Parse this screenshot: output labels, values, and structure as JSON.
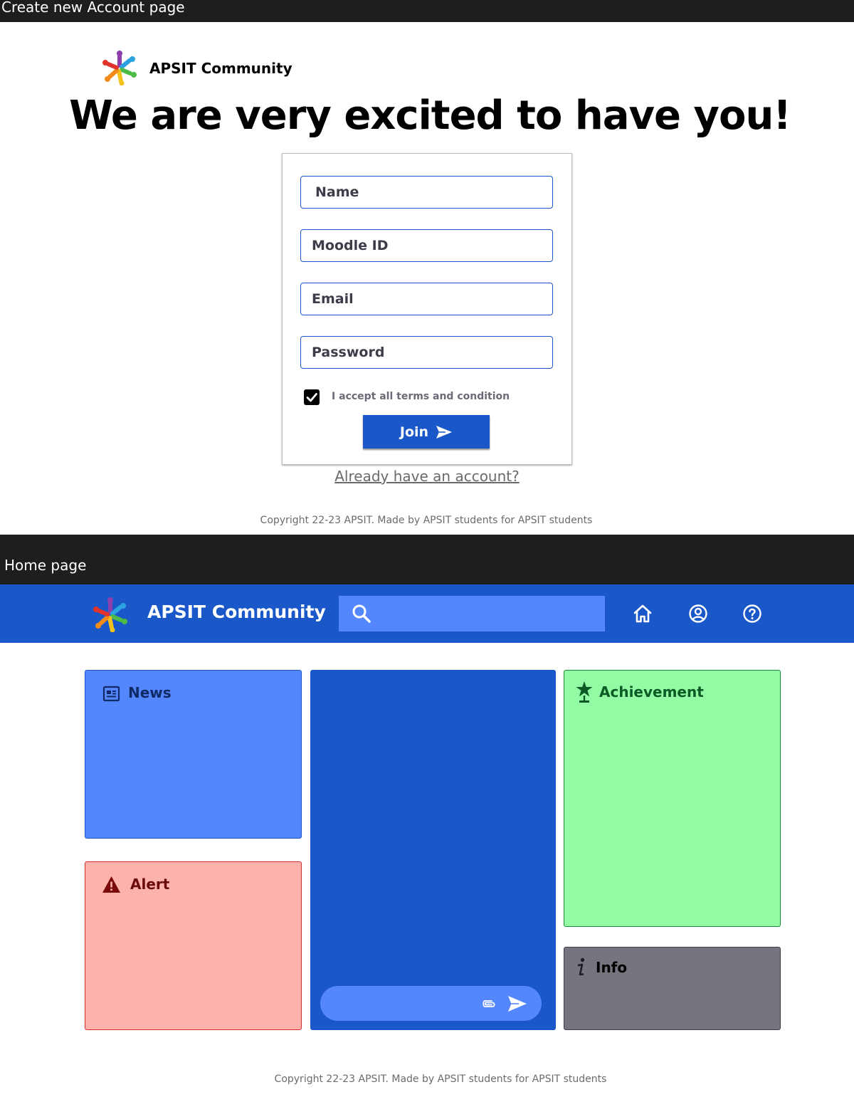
{
  "signup_section": {
    "header_label": "Create new Account page",
    "brand_name": "APSIT Community",
    "headline": "We are very excited to have you!",
    "form": {
      "name_placeholder": "Name",
      "moodle_placeholder": "Moodle ID",
      "email_placeholder": "Email",
      "password_placeholder": "Password",
      "terms_label": "I accept all terms and condition",
      "terms_checked": true,
      "join_label": "Join"
    },
    "login_link": "Already have an account?",
    "copyright": "Copyright 22-23 APSIT. Made by APSIT students for APSIT students"
  },
  "home_section": {
    "header_label": "Home page",
    "navbar": {
      "brand_name": "APSIT Community",
      "search_placeholder": "",
      "icons": [
        "home-icon",
        "user-icon",
        "help-icon"
      ]
    },
    "panels": {
      "news": {
        "title": "News",
        "icon": "newspaper-icon"
      },
      "alert": {
        "title": "Alert",
        "icon": "warning-icon"
      },
      "achievement": {
        "title": "Achievement",
        "icon": "trophy-star-icon"
      },
      "info": {
        "title": "Info",
        "icon": "info-icon"
      }
    },
    "chat": {
      "input_placeholder": "",
      "icons": [
        "attach-icon",
        "send-icon"
      ]
    },
    "copyright": "Copyright 22-23 APSIT. Made by APSIT students for APSIT students"
  },
  "colors": {
    "primary": "#1a58c9",
    "primary_light": "#5487fd",
    "alert_bg": "#fdb3ab",
    "achievement_bg": "#93fba4",
    "info_bg": "#757580",
    "dark_bar": "#1e1e1e"
  }
}
